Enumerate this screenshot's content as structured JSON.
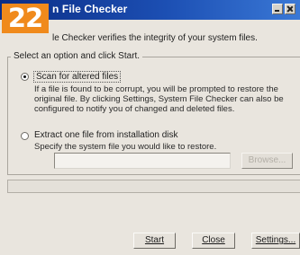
{
  "badge": {
    "number": "22",
    "color": "#f08a1c"
  },
  "window": {
    "title": "n File Checker",
    "titlebar_color": "#1c4fb3"
  },
  "description": "le Checker verifies the integrity of your system files.",
  "group": {
    "legend": "Select an option and click Start.",
    "option_scan": {
      "label": "Scan for altered files",
      "selected": true,
      "text": "If a file is found to be corrupt, you will be prompted to restore the original file. By clicking Settings, System File Checker can also be configured to notify you of changed and deleted files."
    },
    "option_extract": {
      "label": "Extract one file from installation disk",
      "selected": false,
      "text": "Specify the system file you would like to restore.",
      "path_value": "",
      "browse_label": "Browse..."
    }
  },
  "status_text": "",
  "buttons": {
    "start": "Start",
    "close": "Close",
    "settings": "Settings..."
  }
}
